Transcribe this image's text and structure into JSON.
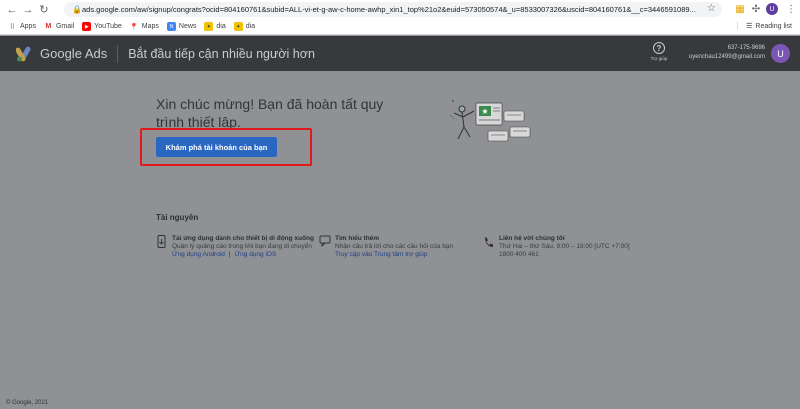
{
  "browser": {
    "url": "ads.google.com/aw/signup/congrats?ocid=804160761&subid=ALL-vi-et-g-aw-c-home-awhp_xin1_top%21o2&euid=573050574&_u=8533007326&uscid=804160761&__c=3446591089...",
    "reading_list": "Reading list",
    "profile_initial": "U"
  },
  "bookmarks": [
    {
      "label": "Apps",
      "icon": "apps-grid-icon"
    },
    {
      "label": "Gmail",
      "icon": "gmail-icon"
    },
    {
      "label": "YouTube",
      "icon": "youtube-icon"
    },
    {
      "label": "Maps",
      "icon": "maps-icon"
    },
    {
      "label": "News",
      "icon": "news-icon"
    },
    {
      "label": "dia",
      "icon": "dia-icon"
    },
    {
      "label": "dia",
      "icon": "dia-icon"
    }
  ],
  "header": {
    "product": "Google Ads",
    "title": "Bắt đầu tiếp cận nhiều người hơn",
    "help_label": "Trợ giúp",
    "account_id": "637-175-9696",
    "account_email": "uyenchau12499@gmail.com",
    "avatar_initial": "U"
  },
  "main": {
    "headline": "Xin chúc mừng! Bạn đã hoàn tất quy trình thiết lập.",
    "cta_label": "Khám phá tài khoản của bạn"
  },
  "resources": {
    "title": "Tài nguyên",
    "items": [
      {
        "title": "Tải ứng dụng dành cho thiết bị di động xuống",
        "desc": "Quản lý quảng cáo trong khi bạn đang di chuyển",
        "link1": "Ứng dụng Android",
        "link2": "Ứng dụng iOS"
      },
      {
        "title": "Tìm hiểu thêm",
        "desc": "Nhận câu trả lời cho các câu hỏi của bạn",
        "link1": "Truy cập vào Trung tâm trợ giúp"
      },
      {
        "title": "Liên hệ với chúng tôi",
        "desc": "Thứ Hai – thứ Sáu, 9:00 – 18:00 [UTC +7:00]",
        "phone": "1800 400 461"
      }
    ]
  },
  "footer": "© Google, 2021",
  "colors": {
    "overlay": "#8f9194",
    "cta": "#2a67c1",
    "highlight": "#e01b1b",
    "header": "#38393c"
  }
}
